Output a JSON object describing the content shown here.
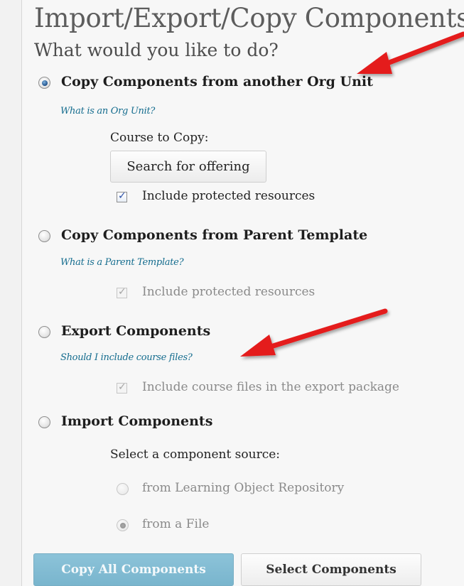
{
  "header": {
    "title": "Import/Export/Copy Components",
    "subtitle": "What would you like to do?"
  },
  "options": {
    "copy_org": {
      "label": "Copy Components from another Org Unit",
      "help": "What is an Org Unit?",
      "course_label": "Course to Copy:",
      "search_button": "Search for offering",
      "include_protected": "Include protected resources"
    },
    "copy_parent": {
      "label": "Copy Components from Parent Template",
      "help": "What is a Parent Template?",
      "include_protected": "Include protected resources"
    },
    "export": {
      "label": "Export Components",
      "help": "Should I include course files?",
      "include_files": "Include course files in the export package"
    },
    "import": {
      "label": "Import Components",
      "source_label": "Select a component source:",
      "source_lor": "from Learning Object Repository",
      "source_file": "from a File"
    }
  },
  "footer": {
    "copy_all": "Copy All Components",
    "select": "Select Components"
  },
  "colors": {
    "accent_primary": "#7fbbd2",
    "help_link": "#146c8e",
    "arrow": "#e41e1e"
  }
}
